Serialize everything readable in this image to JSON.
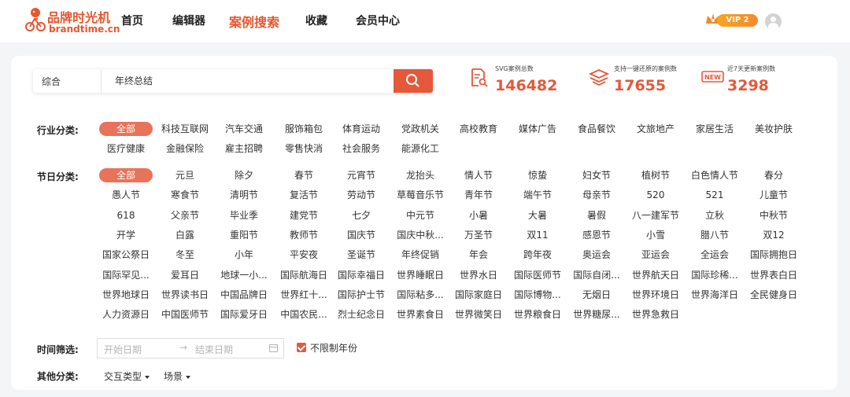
{
  "header": {
    "logo_cn": "品牌时光机",
    "logo_en": "brandtime.cn",
    "nav": [
      "首页",
      "编辑器",
      "案例搜索",
      "收藏",
      "会员中心"
    ],
    "nav_active": "案例搜索",
    "vip_label": "VIP 2"
  },
  "search": {
    "category": "综合",
    "query": "年终总结"
  },
  "stats": [
    {
      "label": "SVG案例总数",
      "value": "146482",
      "icon": "document-search-icon"
    },
    {
      "label": "支持一键还原的案例数",
      "value": "17655",
      "icon": "restore-icon"
    },
    {
      "label": "近7天更新案例数",
      "value": "3298",
      "icon": "new-badge-icon"
    }
  ],
  "filters": {
    "industry_label": "行业分类:",
    "industry": [
      "全部",
      "科技互联网",
      "汽车交通",
      "服饰箱包",
      "体育运动",
      "党政机关",
      "高校教育",
      "媒体广告",
      "食品餐饮",
      "文旅地产",
      "家居生活",
      "美妆护肤",
      "医疗健康",
      "金融保险",
      "雇主招聘",
      "零售快消",
      "社会服务",
      "能源化工"
    ],
    "holiday_label": "节日分类:",
    "holiday": [
      "全部",
      "元旦",
      "除夕",
      "春节",
      "元宵节",
      "龙抬头",
      "情人节",
      "惊蛰",
      "妇女节",
      "植树节",
      "白色情人节",
      "春分",
      "愚人节",
      "寒食节",
      "清明节",
      "复活节",
      "劳动节",
      "草莓音乐节",
      "青年节",
      "端午节",
      "母亲节",
      "520",
      "521",
      "儿童节",
      "618",
      "父亲节",
      "毕业季",
      "建党节",
      "七夕",
      "中元节",
      "小暑",
      "大暑",
      "暑假",
      "八一建军节",
      "立秋",
      "中秋节",
      "开学",
      "白露",
      "重阳节",
      "教师节",
      "国庆节",
      "国庆中秋...",
      "万圣节",
      "双11",
      "感恩节",
      "小雪",
      "腊八节",
      "双12",
      "国家公祭日",
      "冬至",
      "小年",
      "平安夜",
      "圣诞节",
      "年终促销",
      "年会",
      "跨年夜",
      "奥运会",
      "亚运会",
      "全运会",
      "国际拥抱日",
      "国际罕见...",
      "爱耳日",
      "地球一小...",
      "国际航海日",
      "国际幸福日",
      "世界睡眠日",
      "世界水日",
      "国际医师节",
      "国际自闭...",
      "世界航天日",
      "国际珍稀...",
      "世界表白日",
      "世界地球日",
      "世界读书日",
      "中国品牌日",
      "世界红十...",
      "国际护士节",
      "国际粘多...",
      "国际家庭日",
      "国际博物...",
      "无烟日",
      "世界环境日",
      "世界海洋日",
      "全民健身日",
      "人力资源日",
      "中国医师节",
      "国际爱牙日",
      "中国农民...",
      "烈士纪念日",
      "世界素食日",
      "世界微笑日",
      "世界粮食日",
      "世界糖尿...",
      "世界急救日"
    ],
    "time_label": "时间筛选:",
    "date_start_placeholder": "开始日期",
    "date_arrow": "→",
    "date_end_placeholder": "结束日期",
    "unlimited_year": "不限制年份",
    "other_label": "其他分类:",
    "other": [
      "交互类型",
      "场景"
    ]
  },
  "colors": {
    "accent": "#e5583a"
  }
}
